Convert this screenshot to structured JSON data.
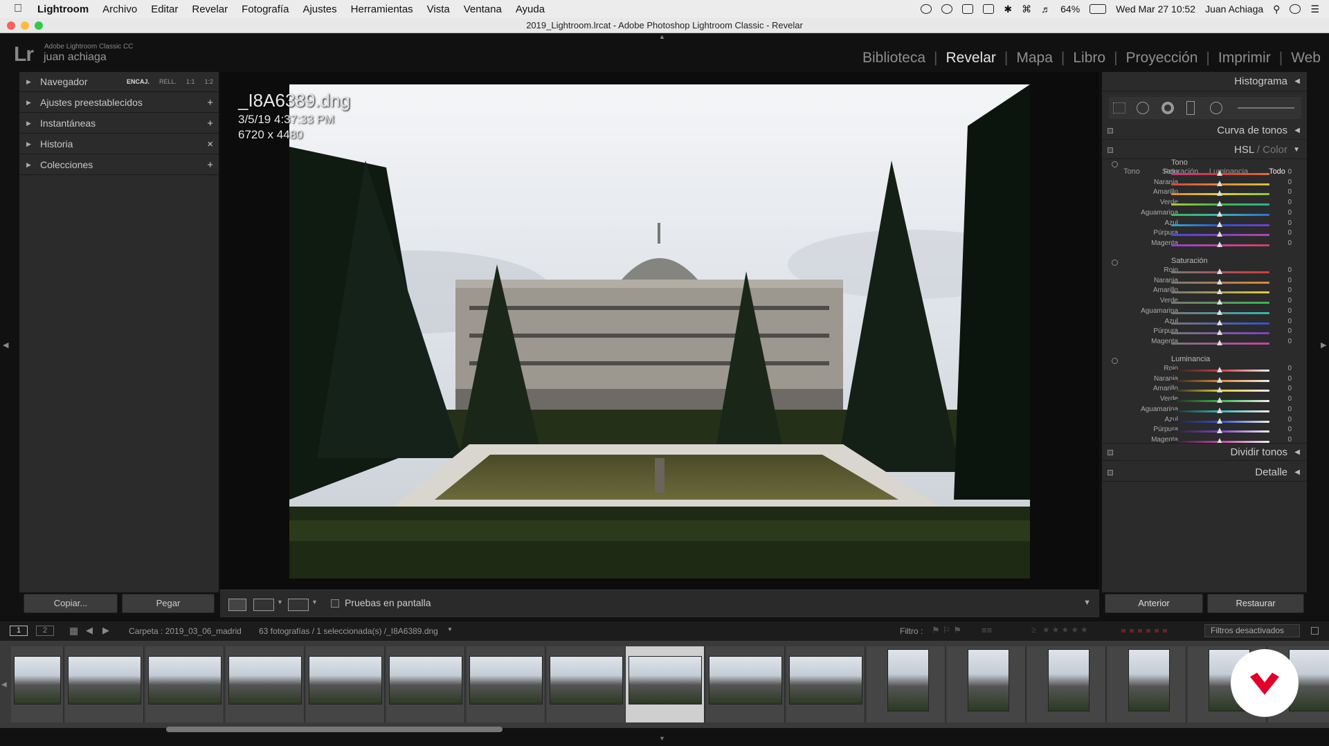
{
  "menubar": {
    "items": [
      "Lightroom",
      "Archivo",
      "Editar",
      "Revelar",
      "Fotografía",
      "Ajustes",
      "Herramientas",
      "Vista",
      "Ventana",
      "Ayuda"
    ],
    "battery": "64%",
    "clock": "Wed Mar 27  10:52",
    "user": "Juan Achiaga"
  },
  "window": {
    "title": "2019_Lightroom.lrcat - Adobe Photoshop Lightroom Classic - Revelar"
  },
  "identity": {
    "logo": "Lr",
    "product": "Adobe Lightroom Classic CC",
    "user": "juan achiaga"
  },
  "modules": [
    "Biblioteca",
    "Revelar",
    "Mapa",
    "Libro",
    "Proyección",
    "Imprimir",
    "Web"
  ],
  "left_panel": {
    "navigator": {
      "label": "Navegador",
      "options": [
        "ENCAJ.",
        "RELL.",
        "1:1",
        "1:2"
      ]
    },
    "sections": [
      {
        "label": "Ajustes preestablecidos",
        "action": "+"
      },
      {
        "label": "Instantáneas",
        "action": "+"
      },
      {
        "label": "Historia",
        "action": "×"
      },
      {
        "label": "Colecciones",
        "action": "+"
      }
    ],
    "copy_button": "Copiar...",
    "paste_button": "Pegar"
  },
  "photo_info": {
    "filename": "_I8A6389.dng",
    "datetime": "3/5/19 4:37:33 PM",
    "dimensions": "6720 x 4480"
  },
  "toolbar": {
    "proof_label": "Pruebas en pantalla"
  },
  "right_panel": {
    "histogram": "Histograma",
    "tone_curve": "Curva de tonos",
    "hsl_header_a": "HSL",
    "hsl_header_sep": " / ",
    "hsl_header_b": "Color",
    "tabs": [
      "Tono",
      "Saturación",
      "Luminancia",
      "Todo"
    ],
    "groups": [
      {
        "title": "Tono",
        "rows": [
          {
            "label": "Rojo",
            "value": "0"
          },
          {
            "label": "Naranja",
            "value": "0"
          },
          {
            "label": "Amarillo",
            "value": "0"
          },
          {
            "label": "Verde",
            "value": "0"
          },
          {
            "label": "Aguamarina",
            "value": "0"
          },
          {
            "label": "Azul",
            "value": "0"
          },
          {
            "label": "Púrpura",
            "value": "0"
          },
          {
            "label": "Magenta",
            "value": "0"
          }
        ]
      },
      {
        "title": "Saturación",
        "rows": [
          {
            "label": "Rojo",
            "value": "0"
          },
          {
            "label": "Naranja",
            "value": "0"
          },
          {
            "label": "Amarillo",
            "value": "0"
          },
          {
            "label": "Verde",
            "value": "0"
          },
          {
            "label": "Aguamarina",
            "value": "0"
          },
          {
            "label": "Azul",
            "value": "0"
          },
          {
            "label": "Púrpura",
            "value": "0"
          },
          {
            "label": "Magenta",
            "value": "0"
          }
        ]
      },
      {
        "title": "Luminancia",
        "rows": [
          {
            "label": "Rojo",
            "value": "0"
          },
          {
            "label": "Naranja",
            "value": "0"
          },
          {
            "label": "Amarillo",
            "value": "0"
          },
          {
            "label": "Verde",
            "value": "0"
          },
          {
            "label": "Aguamarina",
            "value": "0"
          },
          {
            "label": "Azul",
            "value": "0"
          },
          {
            "label": "Púrpura",
            "value": "0"
          },
          {
            "label": "Magenta",
            "value": "0"
          }
        ]
      }
    ],
    "split_toning": "Dividir tonos",
    "detail": "Detalle",
    "previous_button": "Anterior",
    "reset_button": "Restaurar"
  },
  "filmstrip_bar": {
    "page1": "1",
    "page2": "2",
    "source": "Carpeta : 2019_03_06_madrid",
    "count": "63 fotografías / 1 seleccionada(s) /_I8A6389.dng",
    "filter_label": "Filtro :",
    "filter_value": "Filtros desactivados"
  },
  "colors": {
    "accent": "#e6e6e6",
    "panel": "#2b2b2b",
    "badge": "#e0002a"
  }
}
